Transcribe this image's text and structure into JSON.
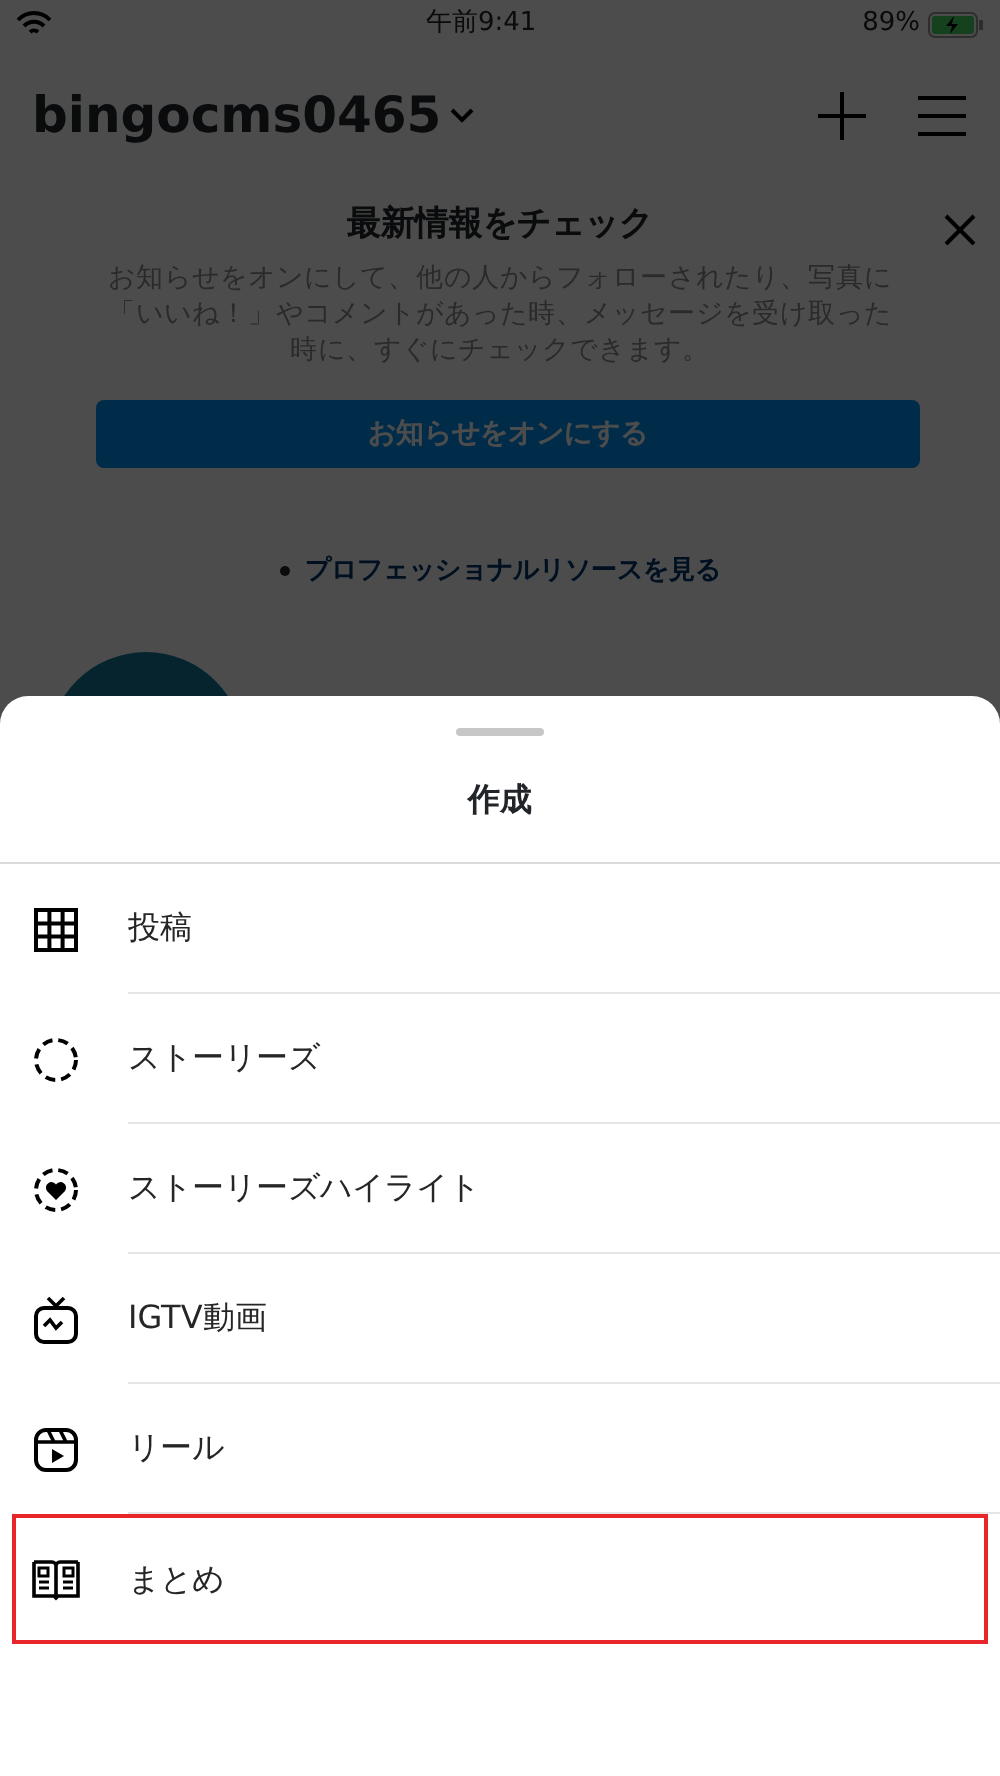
{
  "status_bar": {
    "time": "午前9:41",
    "battery": "89%"
  },
  "header": {
    "username": "bingocms0465"
  },
  "notice": {
    "title": "最新情報をチェック",
    "body": "お知らせをオンにして、他の人からフォローされたり、写真に「いいね！」やコメントがあった時、メッセージを受け取った時に、すぐにチェックできます。",
    "button": "お知らせをオンにする",
    "link": "プロフェッショナルリソースを見る"
  },
  "sheet": {
    "title": "作成",
    "items": [
      {
        "kind": "grid",
        "label": "投稿",
        "highlighted": false
      },
      {
        "kind": "story",
        "label": "ストーリーズ",
        "highlighted": false
      },
      {
        "kind": "highlight",
        "label": "ストーリーズハイライト",
        "highlighted": false
      },
      {
        "kind": "igtv",
        "label": "IGTV動画",
        "highlighted": false
      },
      {
        "kind": "reel",
        "label": "リール",
        "highlighted": false
      },
      {
        "kind": "guide",
        "label": "まとめ",
        "highlighted": true
      }
    ]
  }
}
